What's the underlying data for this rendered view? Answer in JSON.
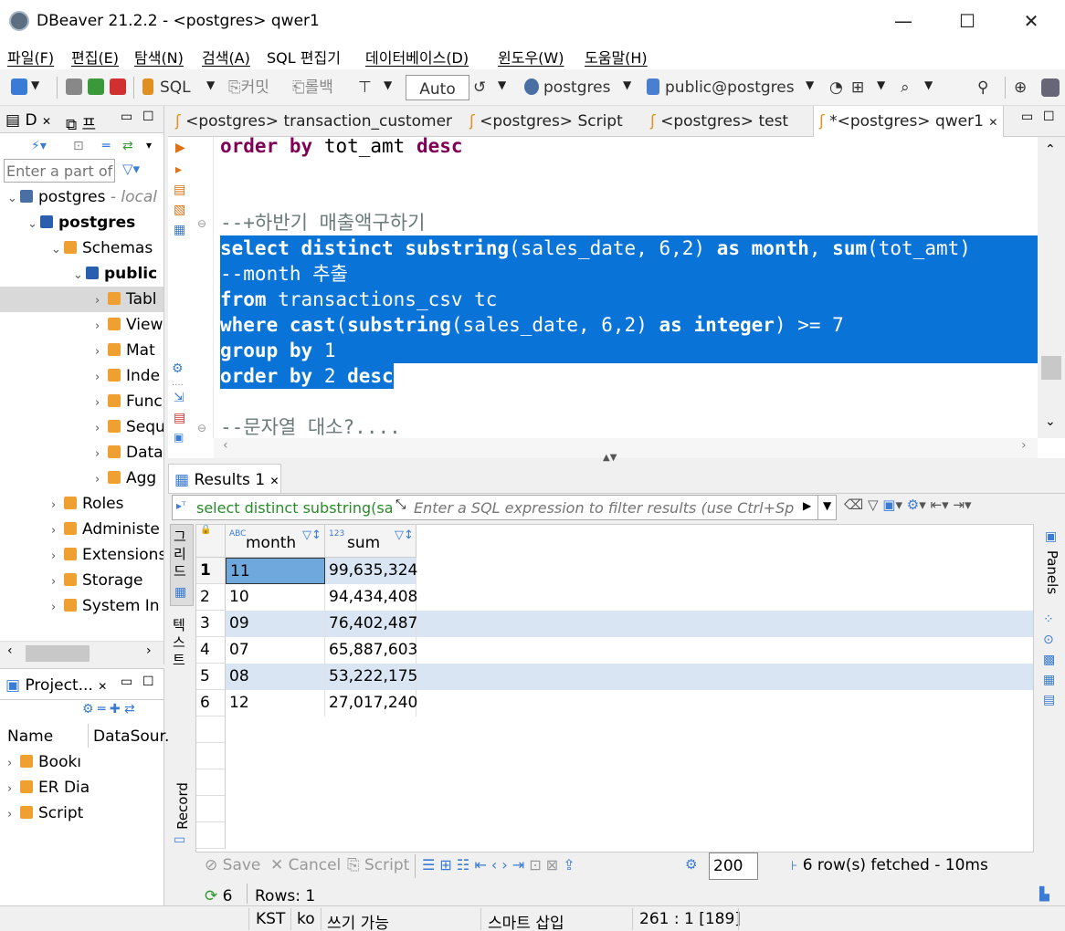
{
  "window": {
    "title": "DBeaver 21.2.2 - <postgres> qwer1"
  },
  "menu": [
    "파일(F)",
    "편집(E)",
    "탐색(N)",
    "검색(A)",
    "SQL 편집기",
    "데이터베이스(D)",
    "윈도우(W)",
    "도움말(H)"
  ],
  "toolbar": {
    "sql_label": "SQL",
    "commit_label": "커밋",
    "rollback_label": "롤백",
    "tx_mode": "Auto",
    "datasource": "postgres",
    "schema": "public@postgres"
  },
  "navigator": {
    "tab1": "D",
    "tab2": "프",
    "filter_placeholder": "Enter a part of",
    "tree": [
      {
        "label": "postgres",
        "suffix": " - local",
        "level": 0,
        "expanded": true,
        "bold": false
      },
      {
        "label": "postgres",
        "suffix": "",
        "level": 1,
        "expanded": true,
        "bold": true
      },
      {
        "label": "Schemas",
        "suffix": "",
        "level": 2,
        "expanded": true,
        "bold": false
      },
      {
        "label": "public",
        "suffix": "",
        "level": 3,
        "expanded": true,
        "bold": true
      },
      {
        "label": "Tabl",
        "suffix": "",
        "level": 4,
        "expanded": false,
        "bold": false
      },
      {
        "label": "View",
        "suffix": "",
        "level": 4,
        "expanded": false,
        "bold": false
      },
      {
        "label": "Mat",
        "suffix": "",
        "level": 4,
        "expanded": false,
        "bold": false
      },
      {
        "label": "Inde",
        "suffix": "",
        "level": 4,
        "expanded": false,
        "bold": false
      },
      {
        "label": "Func",
        "suffix": "",
        "level": 4,
        "expanded": false,
        "bold": false
      },
      {
        "label": "Sequ",
        "suffix": "",
        "level": 4,
        "expanded": false,
        "bold": false
      },
      {
        "label": "Data",
        "suffix": "",
        "level": 4,
        "expanded": false,
        "bold": false
      },
      {
        "label": "Agg",
        "suffix": "",
        "level": 4,
        "expanded": false,
        "bold": false
      },
      {
        "label": "Roles",
        "suffix": "",
        "level": 2,
        "expanded": false,
        "bold": false
      },
      {
        "label": "Administe",
        "suffix": "",
        "level": 2,
        "expanded": false,
        "bold": false
      },
      {
        "label": "Extensions",
        "suffix": "",
        "level": 2,
        "expanded": false,
        "bold": false
      },
      {
        "label": "Storage",
        "suffix": "",
        "level": 2,
        "expanded": false,
        "bold": false
      },
      {
        "label": "System In",
        "suffix": "",
        "level": 2,
        "expanded": false,
        "bold": false
      }
    ]
  },
  "projects": {
    "tab": "Project...",
    "col_name": "Name",
    "col_ds": "DataSour.",
    "items": [
      "Bookı",
      "ER Dia",
      "Script"
    ]
  },
  "editor": {
    "tabs": [
      "<postgres> transaction_customer",
      "<postgres> Script",
      "<postgres> test",
      "*<postgres> qwer1"
    ],
    "lines": [
      {
        "text": "order by tot_amt desc",
        "sel": false
      },
      {
        "text": "",
        "sel": false
      },
      {
        "text": "",
        "sel": false
      },
      {
        "text": "--+하반기 매출액구하기",
        "sel": false
      },
      {
        "text": "select distinct substring(sales_date, 6,2) as month, sum(tot_amt)",
        "sel": true
      },
      {
        "text": "--month 추출",
        "sel": true
      },
      {
        "text": "from transactions_csv tc",
        "sel": true
      },
      {
        "text": "where cast(substring(sales_date, 6,2) as integer) >= 7",
        "sel": true
      },
      {
        "text": "group by 1",
        "sel": true
      },
      {
        "text": "order by 2 desc",
        "sel": true
      },
      {
        "text": "",
        "sel": false
      },
      {
        "text": "--문자열 대소?....",
        "sel": false
      }
    ]
  },
  "results": {
    "tab": "Results 1",
    "query_preview": "select distinct substring(sa",
    "filter_placeholder": "Enter a SQL expression to filter results (use Ctrl+Sp",
    "side_grid": "그리드",
    "side_text": "텍스트",
    "side_record": "Record",
    "panels_label": "Panels",
    "columns": [
      {
        "name": "month",
        "type": "ABC"
      },
      {
        "name": "sum",
        "type": "123"
      }
    ],
    "rows": [
      [
        "11",
        "99,635,324"
      ],
      [
        "10",
        "94,434,408"
      ],
      [
        "09",
        "76,402,487"
      ],
      [
        "07",
        "65,887,603"
      ],
      [
        "08",
        "53,222,175"
      ],
      [
        "12",
        "27,017,240"
      ]
    ],
    "bottom": {
      "save": "Save",
      "cancel": "Cancel",
      "script": "Script",
      "fetch_size": "200",
      "fetched": "6 row(s) fetched - 10ms",
      "refresh_count": "6",
      "rows_label": "Rows: 1"
    }
  },
  "statusbar": {
    "tz": "KST",
    "locale": "ko",
    "mode": "쓰기 가능",
    "insert": "스마트 삽입",
    "pos": "261 : 1 [189]"
  }
}
